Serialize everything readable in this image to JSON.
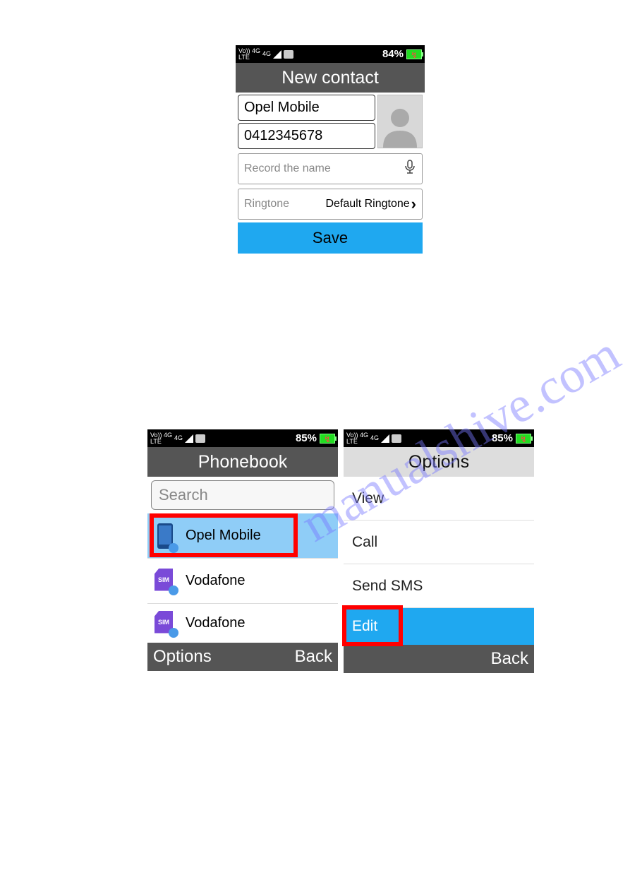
{
  "watermark": "manualshive.com",
  "screen1": {
    "statusbar": {
      "net": "Vo)) 4G",
      "lte": "LTE",
      "sig": "4G",
      "battery": "84%"
    },
    "title": "New contact",
    "name": "Opel Mobile",
    "number": "0412345678",
    "record_placeholder": "Record the name",
    "ringtone_label": "Ringtone",
    "ringtone_value": "Default Ringtone",
    "save": "Save"
  },
  "screen2": {
    "statusbar": {
      "net": "Vo)) 4G",
      "lte": "LTE",
      "sig": "4G",
      "battery": "85%"
    },
    "title": "Phonebook",
    "search_placeholder": "Search",
    "contacts": [
      {
        "name": "Opel Mobile",
        "type": "phone",
        "selected": true
      },
      {
        "name": "Vodafone",
        "type": "sim"
      },
      {
        "name": "Vodafone",
        "type": "sim"
      }
    ],
    "soft_left": "Options",
    "soft_right": "Back"
  },
  "screen3": {
    "statusbar": {
      "net": "Vo)) 4G",
      "lte": "LTE",
      "sig": "4G",
      "battery": "85%"
    },
    "title": "Options",
    "options": [
      {
        "label": "View"
      },
      {
        "label": "Call"
      },
      {
        "label": "Send SMS"
      },
      {
        "label": "Edit",
        "selected": true
      }
    ],
    "soft_right": "Back"
  }
}
